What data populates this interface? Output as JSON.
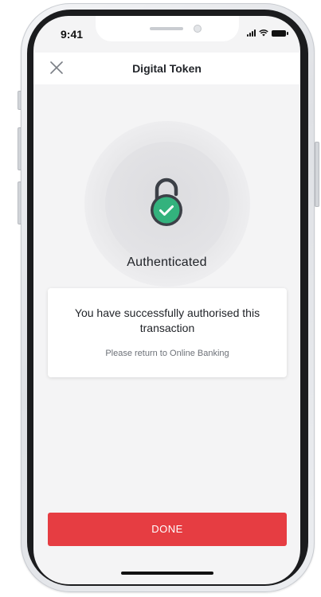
{
  "status_bar": {
    "time": "9:41"
  },
  "header": {
    "title": "Digital Token",
    "close_icon": "close-icon"
  },
  "auth": {
    "status": "Authenticated",
    "icon": "lock-check-icon",
    "accent_color": "#33b27d"
  },
  "message": {
    "main": "You have successfully authorised this transaction",
    "sub": "Please return to Online Banking"
  },
  "actions": {
    "done_label": "DONE",
    "done_color": "#e63d42"
  }
}
